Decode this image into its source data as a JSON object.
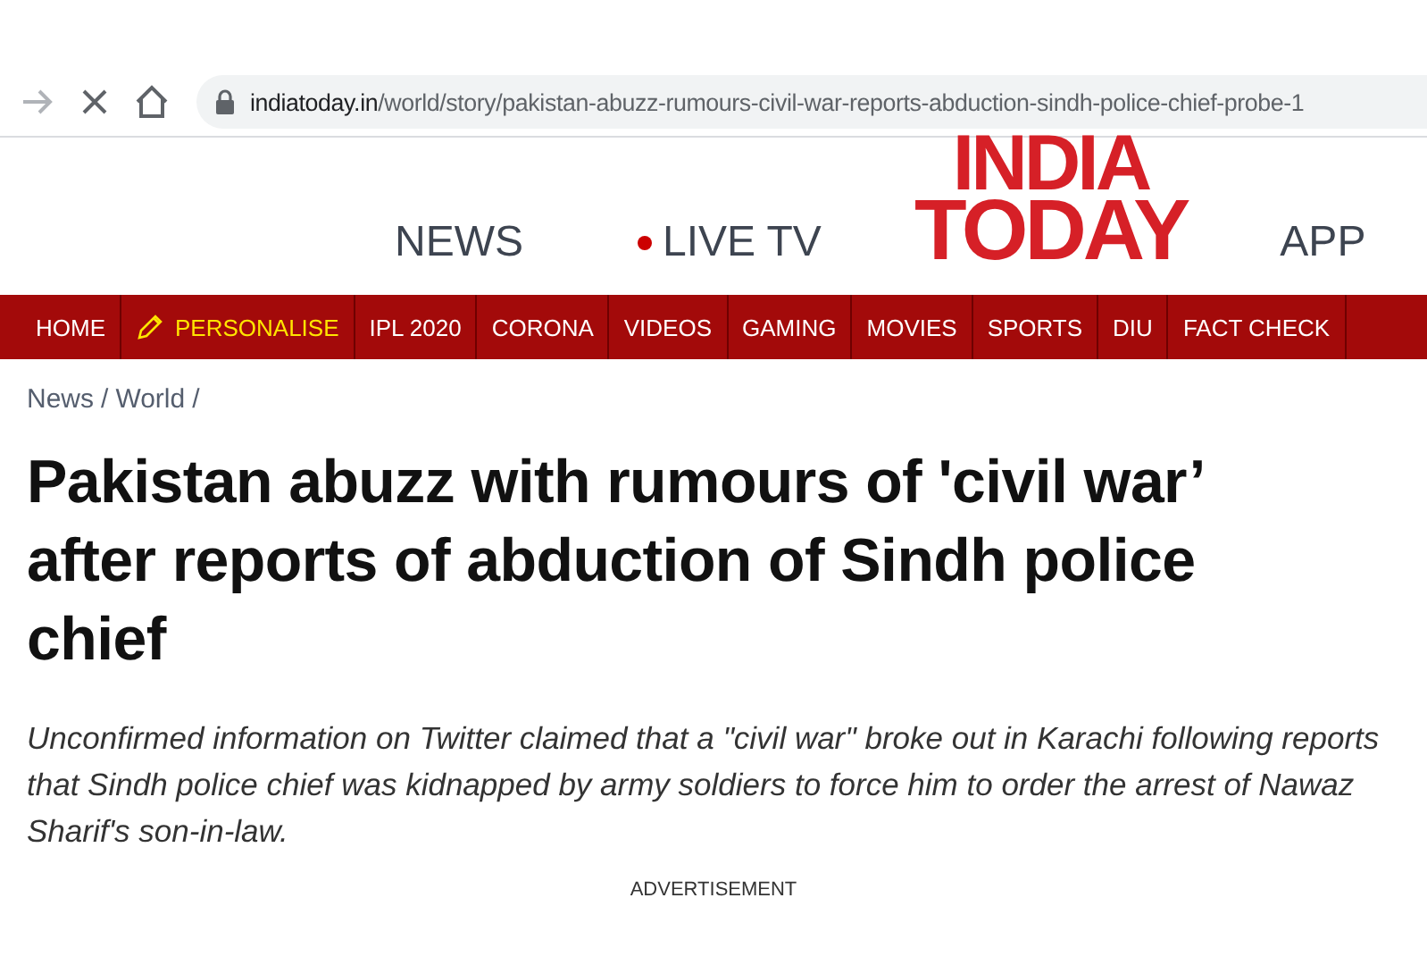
{
  "browser": {
    "url_host": "indiatoday.in",
    "url_path": "/world/story/pakistan-abuzz-rumours-civil-war-reports-abduction-sindh-police-chief-probe-1",
    "loading": true
  },
  "header": {
    "links": [
      {
        "label": "NEWS",
        "kind": "plain"
      },
      {
        "label": "LIVE TV",
        "kind": "live"
      },
      {
        "label": "APP",
        "kind": "plain"
      }
    ],
    "logo_top": "INDIA",
    "logo_bottom": "TODAY"
  },
  "nav": [
    {
      "label": "HOME",
      "kind": "plain"
    },
    {
      "label": "PERSONALISE",
      "kind": "personalise"
    },
    {
      "label": "IPL 2020",
      "kind": "plain"
    },
    {
      "label": "CORONA",
      "kind": "plain"
    },
    {
      "label": "VIDEOS",
      "kind": "plain"
    },
    {
      "label": "GAMING",
      "kind": "plain"
    },
    {
      "label": "MOVIES",
      "kind": "plain"
    },
    {
      "label": "SPORTS",
      "kind": "plain"
    },
    {
      "label": "DIU",
      "kind": "plain"
    },
    {
      "label": "FACT CHECK",
      "kind": "plain"
    }
  ],
  "breadcrumb": [
    {
      "label": "News",
      "separator": "/"
    },
    {
      "label": "World",
      "separator": "/"
    }
  ],
  "article": {
    "headline": "Pakistan abuzz with rumours of 'civil war’ after reports of abduction of Sindh police chief",
    "summary": "Unconfirmed information on Twitter claimed that a \"civil war\" broke out in Karachi following reports that Sindh police chief was kidnapped by army soldiers to force him to order the arrest of Nawaz Sharif's son-in-law.",
    "ad_label": "ADVERTISEMENT"
  }
}
